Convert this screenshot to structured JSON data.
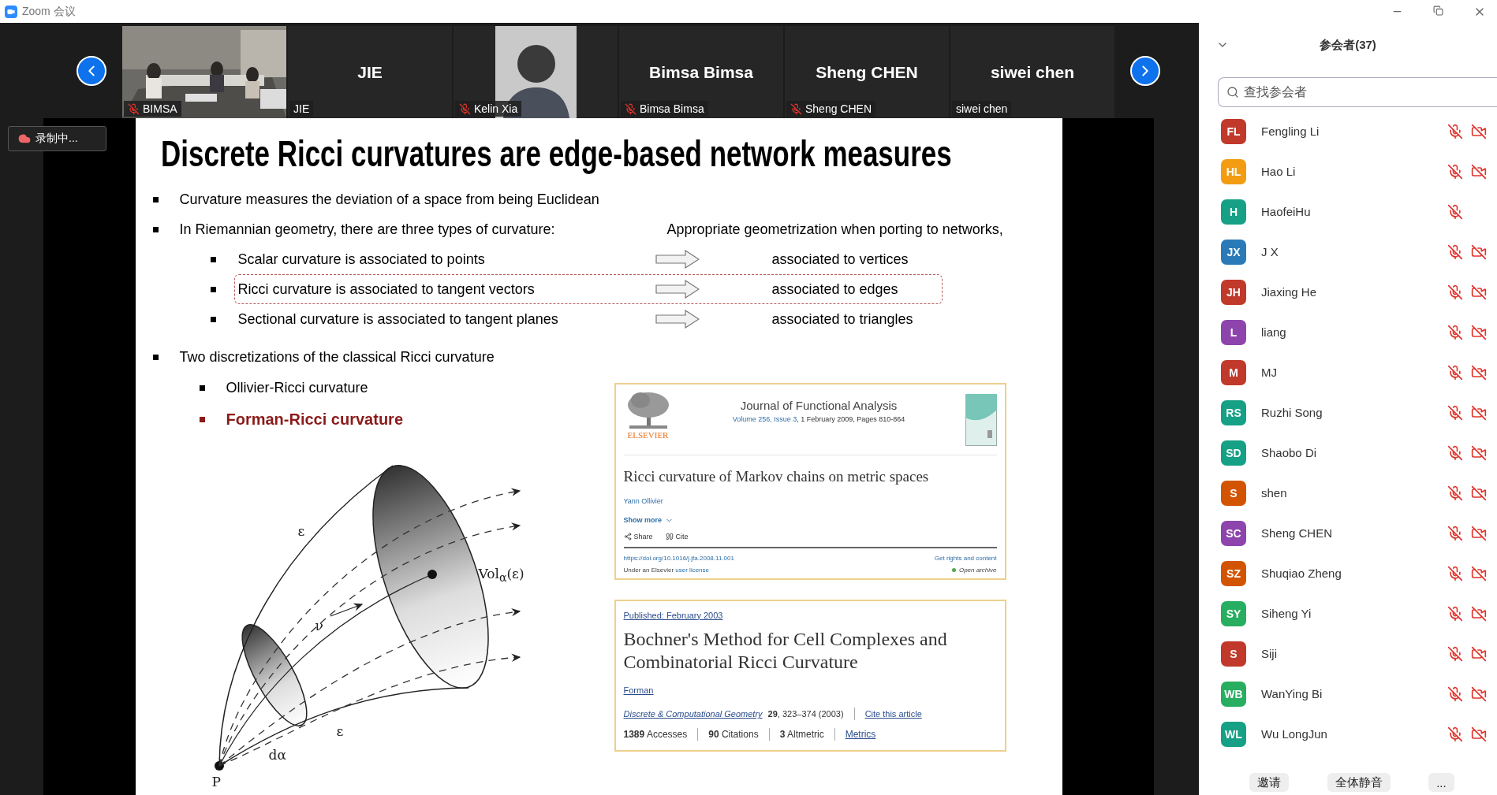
{
  "window": {
    "title": "Zoom 会议"
  },
  "thumbnails": [
    {
      "kind": "video",
      "name": "BIMSA",
      "muted": true
    },
    {
      "kind": "name",
      "display": "JIE",
      "name": "JIE",
      "muted": false
    },
    {
      "name": "Kelin Xia",
      "muted": true
    },
    {
      "kind": "name",
      "display": "Bimsa Bimsa",
      "name": "Bimsa Bimsa",
      "muted": true
    },
    {
      "kind": "name",
      "display": "Sheng CHEN",
      "name": "Sheng CHEN",
      "muted": true
    },
    {
      "kind": "name",
      "display": "siwei chen",
      "name": "siwei chen",
      "muted": false
    }
  ],
  "recording": {
    "label": "录制中..."
  },
  "slide": {
    "title": "Discrete Ricci curvatures are edge-based network measures",
    "points": [
      {
        "kind": "bullet",
        "text": "Curvature measures the deviation of a space from being Euclidean"
      },
      {
        "kind": "bullet",
        "text": "In Riemannian geometry, there are three types of curvature:",
        "aside": "Appropriate geometrization when porting to networks,"
      },
      {
        "kind": "mapping",
        "text": "Scalar curvature is associated to points",
        "result": "associated to vertices",
        "highlighted": false
      },
      {
        "kind": "mapping",
        "text": "Ricci curvature is associated to tangent vectors",
        "result": "associated to edges",
        "highlighted": true
      },
      {
        "kind": "mapping",
        "text": "Sectional curvature is associated to tangent planes",
        "result": "associated to triangles",
        "highlighted": false
      },
      {
        "kind": "bullet",
        "text": "Two discretizations of the classical Ricci curvature"
      }
    ],
    "methods": [
      {
        "text": "Ollivier-Ricci curvature",
        "emphasized": false
      },
      {
        "text": "Forman-Ricci curvature",
        "emphasized": true
      }
    ],
    "diagram": {
      "labels": [
        {
          "text": "ε"
        },
        {
          "text": "ν"
        },
        {
          "text": "ε"
        },
        {
          "text": "dα"
        },
        {
          "text": "P"
        },
        {
          "text": "Vol$_{α}$(ε)"
        }
      ]
    },
    "articles": [
      {
        "kind": "elsevier",
        "publisher": "ELSEVIER",
        "journal": "Journal of Functional Analysis",
        "volume": "Volume 256, Issue 3",
        "date": ", 1 February 2009, Pages 810-864",
        "title": "Ricci curvature of Markov chains on metric spaces",
        "author": "Yann Ollivier",
        "show_more": "Show more",
        "actions": [
          "Share",
          "Cite"
        ],
        "doi": "https://doi.org/10.1016/j.jfa.2008.11.001",
        "rights": "Get rights and content",
        "license_prefix": "Under an Elsevier",
        "license_link": "user license",
        "access": "Open archive"
      },
      {
        "kind": "springer",
        "published": "Published: February 2003",
        "title": "Bochner's Method for Cell Complexes and Combinatorial Ricci Curvature",
        "author": "Forman",
        "journal": "Discrete & Computational Geometry",
        "volume": "29",
        "pages": ", 323–374 (2003)",
        "cite": "Cite this article",
        "metrics": [
          {
            "value": "1389",
            "label": "Accesses"
          },
          {
            "value": "90",
            "label": "Citations"
          },
          {
            "value": "3",
            "label": "Altmetric"
          }
        ],
        "metrics_link": "Metrics"
      }
    ]
  },
  "panel": {
    "title": "参会者(37)",
    "search_placeholder": "查找参会者",
    "participants": [
      {
        "initials": "FL",
        "name": "Fengling Li",
        "color": "#c0392b",
        "audio_muted": true,
        "camera_off": true
      },
      {
        "initials": "HL",
        "name": "Hao Li",
        "color": "#f39c12",
        "audio_muted": true,
        "camera_off": true
      },
      {
        "initials": "H",
        "name": "HaofeiHu",
        "color": "#16a085",
        "audio_muted": true,
        "camera_off": false
      },
      {
        "initials": "JX",
        "name": "J X",
        "color": "#2a7ab8",
        "audio_muted": true,
        "camera_off": true
      },
      {
        "initials": "JH",
        "name": "Jiaxing He",
        "color": "#c0392b",
        "audio_muted": true,
        "camera_off": true
      },
      {
        "initials": "L",
        "name": "liang",
        "color": "#8e44ad",
        "audio_muted": true,
        "camera_off": true
      },
      {
        "initials": "M",
        "name": "MJ",
        "color": "#c0392b",
        "audio_muted": true,
        "camera_off": true
      },
      {
        "initials": "RS",
        "name": "Ruzhi Song",
        "color": "#16a085",
        "audio_muted": true,
        "camera_off": true
      },
      {
        "initials": "SD",
        "name": "Shaobo Di",
        "color": "#16a085",
        "audio_muted": true,
        "camera_off": true
      },
      {
        "initials": "S",
        "name": "shen",
        "color": "#d35400",
        "audio_muted": true,
        "camera_off": true
      },
      {
        "initials": "SC",
        "name": "Sheng CHEN",
        "color": "#8e44ad",
        "audio_muted": true,
        "camera_off": true
      },
      {
        "initials": "SZ",
        "name": "Shuqiao Zheng",
        "color": "#d35400",
        "audio_muted": true,
        "camera_off": true
      },
      {
        "initials": "SY",
        "name": "Siheng Yi",
        "color": "#27ae60",
        "audio_muted": true,
        "camera_off": true
      },
      {
        "initials": "S",
        "name": "Siji",
        "color": "#c0392b",
        "audio_muted": true,
        "camera_off": true
      },
      {
        "initials": "WB",
        "name": "WanYing Bi",
        "color": "#27ae60",
        "audio_muted": true,
        "camera_off": true
      },
      {
        "initials": "WL",
        "name": "Wu LongJun",
        "color": "#16a085",
        "audio_muted": true,
        "camera_off": true
      }
    ],
    "buttons": [
      "邀请",
      "全体静音",
      "..."
    ]
  }
}
